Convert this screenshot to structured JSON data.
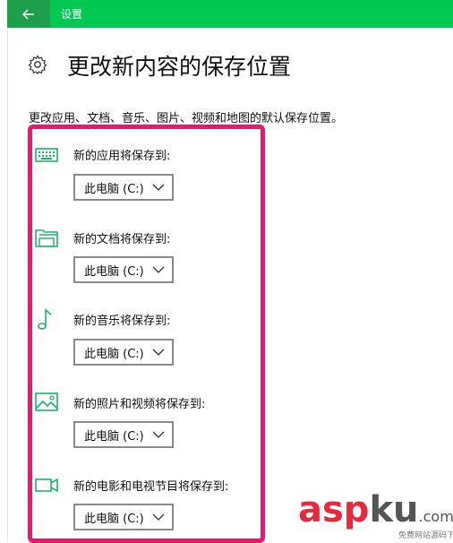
{
  "titlebar": {
    "title": "设置",
    "back_icon": "arrow-left-icon",
    "color": "#00c853"
  },
  "page": {
    "icon": "gear-icon",
    "title": "更改新内容的保存位置",
    "description": "更改应用、文档、音乐、图片、视频和地图的默认保存位置。"
  },
  "highlight_color": "#e9186a",
  "items": [
    {
      "icon": "monitor-icon",
      "label": "新的应用将保存到:",
      "value": "此电脑 (C:)"
    },
    {
      "icon": "folder-icon",
      "label": "新的文档将保存到:",
      "value": "此电脑 (C:)"
    },
    {
      "icon": "music-note-icon",
      "label": "新的音乐将保存到:",
      "value": "此电脑 (C:)"
    },
    {
      "icon": "image-icon",
      "label": "新的照片和视频将保存到:",
      "value": "此电脑 (C:)"
    },
    {
      "icon": "video-camera-icon",
      "label": "新的电影和电视节目将保存到:",
      "value": "此电脑 (C:)"
    }
  ],
  "watermark": {
    "a": "asp",
    "b": "ku",
    "c": ".com",
    "sub": "免费网站源码下载站!"
  }
}
